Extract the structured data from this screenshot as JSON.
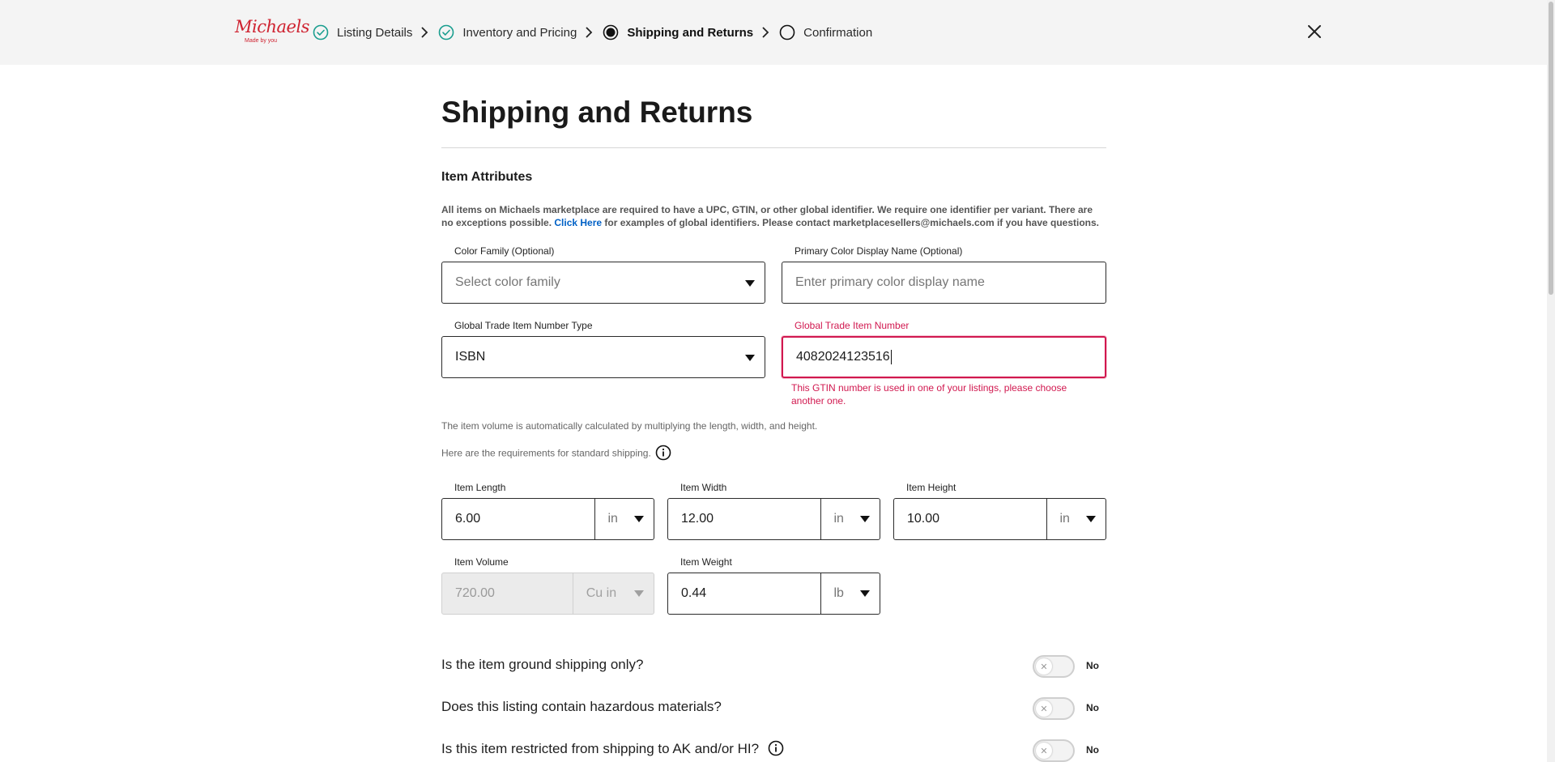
{
  "header": {
    "logo": {
      "brand": "Michaels",
      "tagline": "Made by you"
    },
    "steps": [
      {
        "label": "Listing Details",
        "state": "complete",
        "icon": "check-circle-icon"
      },
      {
        "label": "Inventory and Pricing",
        "state": "complete",
        "icon": "check-circle-icon"
      },
      {
        "label": "Shipping and Returns",
        "state": "active",
        "icon": "radio-filled-icon"
      },
      {
        "label": "Confirmation",
        "state": "pending",
        "icon": "radio-empty-icon"
      }
    ],
    "close_icon": "close-icon"
  },
  "page": {
    "title": "Shipping and Returns",
    "section_title": "Item Attributes",
    "info": {
      "before_link": "All items on Michaels marketplace are required to have a UPC, GTIN, or other global identifier. We require one identifier per variant. There are no exceptions possible. ",
      "link": "Click Here",
      "after_link": " for examples of global identifiers. Please contact marketplacesellers@michaels.com if you have questions."
    }
  },
  "fields": {
    "color_family": {
      "label": "Color Family (Optional)",
      "placeholder": "Select color family"
    },
    "primary_color": {
      "label": "Primary Color Display Name (Optional)",
      "placeholder": "Enter primary color display name"
    },
    "gtin_type": {
      "label": "Global Trade Item Number Type",
      "value": "ISBN"
    },
    "gtin": {
      "label": "Global Trade Item Number",
      "value": "4082024123516",
      "error": "This GTIN number is used in one of your listings, please choose another one."
    }
  },
  "notes": {
    "volume_note": "The item volume is automatically calculated by multiplying the length, width, and height.",
    "shipping_note": "Here are the requirements for standard shipping."
  },
  "dimensions": {
    "length": {
      "label": "Item Length",
      "value": "6.00",
      "unit": "in"
    },
    "width": {
      "label": "Item Width",
      "value": "12.00",
      "unit": "in"
    },
    "height": {
      "label": "Item Height",
      "value": "10.00",
      "unit": "in"
    },
    "volume": {
      "label": "Item Volume",
      "value": "720.00",
      "unit": "Cu in"
    },
    "weight": {
      "label": "Item Weight",
      "value": "0.44",
      "unit": "lb"
    }
  },
  "questions": [
    {
      "text": "Is the item ground shipping only?",
      "toggle": "No"
    },
    {
      "text": "Does this listing contain hazardous materials?",
      "toggle": "No"
    },
    {
      "text": "Is this item restricted from shipping to AK and/or HI?",
      "toggle": "No"
    }
  ],
  "colors": {
    "brand_red": "#cf2331",
    "check_teal": "#1a9e8f",
    "error": "#d1184f",
    "link": "#0061c6"
  }
}
